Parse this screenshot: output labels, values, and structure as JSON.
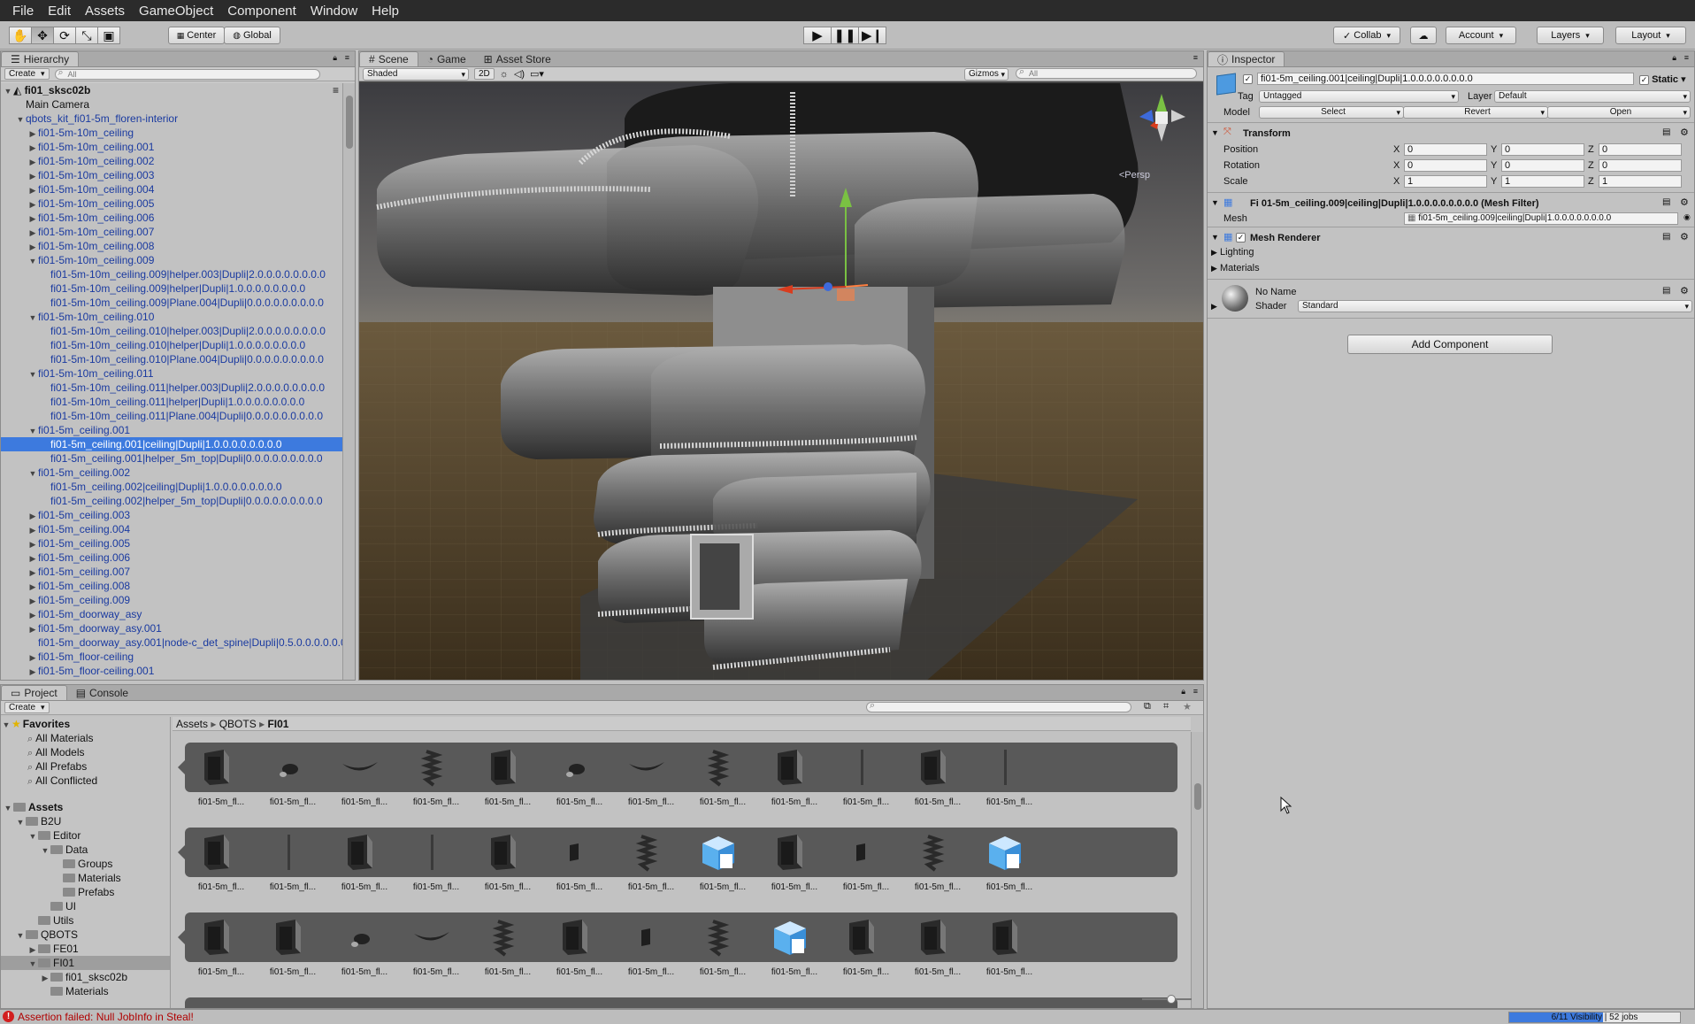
{
  "menubar": {
    "items": [
      "File",
      "Edit",
      "Assets",
      "GameObject",
      "Component",
      "Window",
      "Help"
    ]
  },
  "toolbar": {
    "pivot": "Center",
    "space": "Global",
    "collab": "Collab",
    "account": "Account",
    "layers": "Layers",
    "layout": "Layout"
  },
  "hierarchy": {
    "tab": "Hierarchy",
    "create": "Create",
    "search_placeholder": "All",
    "rows": [
      {
        "label": "fi01_sksc02b",
        "depth": 0,
        "arrow": "open",
        "kind": "scene"
      },
      {
        "label": "Main Camera",
        "depth": 1,
        "arrow": "none",
        "kind": "black"
      },
      {
        "label": "qbots_kit_fi01-5m_floren-interior",
        "depth": 1,
        "arrow": "open",
        "kind": "prefab"
      },
      {
        "label": "fi01-5m-10m_ceiling",
        "depth": 2,
        "arrow": "closed",
        "kind": "prefab"
      },
      {
        "label": "fi01-5m-10m_ceiling.001",
        "depth": 2,
        "arrow": "closed",
        "kind": "prefab"
      },
      {
        "label": "fi01-5m-10m_ceiling.002",
        "depth": 2,
        "arrow": "closed",
        "kind": "prefab"
      },
      {
        "label": "fi01-5m-10m_ceiling.003",
        "depth": 2,
        "arrow": "closed",
        "kind": "prefab"
      },
      {
        "label": "fi01-5m-10m_ceiling.004",
        "depth": 2,
        "arrow": "closed",
        "kind": "prefab"
      },
      {
        "label": "fi01-5m-10m_ceiling.005",
        "depth": 2,
        "arrow": "closed",
        "kind": "prefab"
      },
      {
        "label": "fi01-5m-10m_ceiling.006",
        "depth": 2,
        "arrow": "closed",
        "kind": "prefab"
      },
      {
        "label": "fi01-5m-10m_ceiling.007",
        "depth": 2,
        "arrow": "closed",
        "kind": "prefab"
      },
      {
        "label": "fi01-5m-10m_ceiling.008",
        "depth": 2,
        "arrow": "closed",
        "kind": "prefab"
      },
      {
        "label": "fi01-5m-10m_ceiling.009",
        "depth": 2,
        "arrow": "open",
        "kind": "prefab"
      },
      {
        "label": "fi01-5m-10m_ceiling.009|helper.003|Dupli|2.0.0.0.0.0.0.0.0",
        "depth": 3,
        "arrow": "none",
        "kind": "prefab"
      },
      {
        "label": "fi01-5m-10m_ceiling.009|helper|Dupli|1.0.0.0.0.0.0.0.0",
        "depth": 3,
        "arrow": "none",
        "kind": "prefab"
      },
      {
        "label": "fi01-5m-10m_ceiling.009|Plane.004|Dupli|0.0.0.0.0.0.0.0.0",
        "depth": 3,
        "arrow": "none",
        "kind": "prefab"
      },
      {
        "label": "fi01-5m-10m_ceiling.010",
        "depth": 2,
        "arrow": "open",
        "kind": "prefab"
      },
      {
        "label": "fi01-5m-10m_ceiling.010|helper.003|Dupli|2.0.0.0.0.0.0.0.0",
        "depth": 3,
        "arrow": "none",
        "kind": "prefab"
      },
      {
        "label": "fi01-5m-10m_ceiling.010|helper|Dupli|1.0.0.0.0.0.0.0.0",
        "depth": 3,
        "arrow": "none",
        "kind": "prefab"
      },
      {
        "label": "fi01-5m-10m_ceiling.010|Plane.004|Dupli|0.0.0.0.0.0.0.0.0",
        "depth": 3,
        "arrow": "none",
        "kind": "prefab"
      },
      {
        "label": "fi01-5m-10m_ceiling.011",
        "depth": 2,
        "arrow": "open",
        "kind": "prefab"
      },
      {
        "label": "fi01-5m-10m_ceiling.011|helper.003|Dupli|2.0.0.0.0.0.0.0.0",
        "depth": 3,
        "arrow": "none",
        "kind": "prefab"
      },
      {
        "label": "fi01-5m-10m_ceiling.011|helper|Dupli|1.0.0.0.0.0.0.0.0",
        "depth": 3,
        "arrow": "none",
        "kind": "prefab"
      },
      {
        "label": "fi01-5m-10m_ceiling.011|Plane.004|Dupli|0.0.0.0.0.0.0.0.0",
        "depth": 3,
        "arrow": "none",
        "kind": "prefab"
      },
      {
        "label": "fi01-5m_ceiling.001",
        "depth": 2,
        "arrow": "open",
        "kind": "prefab"
      },
      {
        "label": "fi01-5m_ceiling.001|ceiling|Dupli|1.0.0.0.0.0.0.0.0",
        "depth": 3,
        "arrow": "none",
        "kind": "selected"
      },
      {
        "label": "fi01-5m_ceiling.001|helper_5m_top|Dupli|0.0.0.0.0.0.0.0.0",
        "depth": 3,
        "arrow": "none",
        "kind": "prefab"
      },
      {
        "label": "fi01-5m_ceiling.002",
        "depth": 2,
        "arrow": "open",
        "kind": "prefab"
      },
      {
        "label": "fi01-5m_ceiling.002|ceiling|Dupli|1.0.0.0.0.0.0.0.0",
        "depth": 3,
        "arrow": "none",
        "kind": "prefab"
      },
      {
        "label": "fi01-5m_ceiling.002|helper_5m_top|Dupli|0.0.0.0.0.0.0.0.0",
        "depth": 3,
        "arrow": "none",
        "kind": "prefab"
      },
      {
        "label": "fi01-5m_ceiling.003",
        "depth": 2,
        "arrow": "closed",
        "kind": "prefab"
      },
      {
        "label": "fi01-5m_ceiling.004",
        "depth": 2,
        "arrow": "closed",
        "kind": "prefab"
      },
      {
        "label": "fi01-5m_ceiling.005",
        "depth": 2,
        "arrow": "closed",
        "kind": "prefab"
      },
      {
        "label": "fi01-5m_ceiling.006",
        "depth": 2,
        "arrow": "closed",
        "kind": "prefab"
      },
      {
        "label": "fi01-5m_ceiling.007",
        "depth": 2,
        "arrow": "closed",
        "kind": "prefab"
      },
      {
        "label": "fi01-5m_ceiling.008",
        "depth": 2,
        "arrow": "closed",
        "kind": "prefab"
      },
      {
        "label": "fi01-5m_ceiling.009",
        "depth": 2,
        "arrow": "closed",
        "kind": "prefab"
      },
      {
        "label": "fi01-5m_doorway_asy",
        "depth": 2,
        "arrow": "closed",
        "kind": "prefab"
      },
      {
        "label": "fi01-5m_doorway_asy.001",
        "depth": 2,
        "arrow": "closed",
        "kind": "prefab"
      },
      {
        "label": "fi01-5m_doorway_asy.001|node-c_det_spine|Dupli|0.5.0.0.0.0.0.0",
        "depth": 2,
        "arrow": "none",
        "kind": "prefab"
      },
      {
        "label": "fi01-5m_floor-ceiling",
        "depth": 2,
        "arrow": "closed",
        "kind": "prefab"
      },
      {
        "label": "fi01-5m_floor-ceiling.001",
        "depth": 2,
        "arrow": "closed",
        "kind": "prefab"
      }
    ]
  },
  "scene": {
    "tabs": [
      "Scene",
      "Game",
      "Asset Store"
    ],
    "shading": "Shaded",
    "mode_2d": "2D",
    "gizmos": "Gizmos",
    "search_placeholder": "All",
    "persp_label": "Persp"
  },
  "inspector": {
    "tab": "Inspector",
    "object_name": "fi01-5m_ceiling.001|ceiling|Dupli|1.0.0.0.0.0.0.0.0",
    "static_label": "Static",
    "tag_label": "Tag",
    "tag_value": "Untagged",
    "layer_label": "Layer",
    "layer_value": "Default",
    "model_label": "Model",
    "model_buttons": [
      "Select",
      "Revert",
      "Open"
    ],
    "transform": {
      "title": "Transform",
      "rows": [
        {
          "label": "Position",
          "x": "0",
          "y": "0",
          "z": "0"
        },
        {
          "label": "Rotation",
          "x": "0",
          "y": "0",
          "z": "0"
        },
        {
          "label": "Scale",
          "x": "1",
          "y": "1",
          "z": "1"
        }
      ]
    },
    "mesh_filter": {
      "title": "Fi 01-5m_ceiling.009|ceiling|Dupli|1.0.0.0.0.0.0.0.0 (Mesh Filter)",
      "mesh_label": "Mesh",
      "mesh_value": "fi01-5m_ceiling.009|ceiling|Dupli|1.0.0.0.0.0.0.0.0"
    },
    "mesh_renderer": {
      "title": "Mesh Renderer",
      "lighting": "Lighting",
      "materials": "Materials"
    },
    "material": {
      "name": "No Name",
      "shader_label": "Shader",
      "shader_value": "Standard"
    },
    "add_component": "Add Component"
  },
  "project": {
    "tabs": [
      "Project",
      "Console"
    ],
    "create": "Create",
    "favorites": {
      "title": "Favorites",
      "items": [
        "All Materials",
        "All Models",
        "All Prefabs",
        "All Conflicted"
      ]
    },
    "tree": [
      {
        "label": "Assets",
        "depth": 0,
        "arrow": "open",
        "bold": true
      },
      {
        "label": "B2U",
        "depth": 1,
        "arrow": "open"
      },
      {
        "label": "Editor",
        "depth": 2,
        "arrow": "open"
      },
      {
        "label": "Data",
        "depth": 3,
        "arrow": "open"
      },
      {
        "label": "Groups",
        "depth": 4,
        "arrow": "none"
      },
      {
        "label": "Materials",
        "depth": 4,
        "arrow": "none"
      },
      {
        "label": "Prefabs",
        "depth": 4,
        "arrow": "none"
      },
      {
        "label": "UI",
        "depth": 3,
        "arrow": "none"
      },
      {
        "label": "Utils",
        "depth": 2,
        "arrow": "none"
      },
      {
        "label": "QBOTS",
        "depth": 1,
        "arrow": "open"
      },
      {
        "label": "FE01",
        "depth": 2,
        "arrow": "closed"
      },
      {
        "label": "FI01",
        "depth": 2,
        "arrow": "open",
        "selected": true
      },
      {
        "label": "fi01_sksc02b",
        "depth": 3,
        "arrow": "closed"
      },
      {
        "label": "Materials",
        "depth": 3,
        "arrow": "none"
      }
    ],
    "breadcrumb": [
      "Assets",
      "QBOTS",
      "FI01"
    ],
    "thumb_label": "fi01-5m_fl...",
    "strips": [
      [
        "door",
        "bolt",
        "sweep",
        "spring",
        "door",
        "bolt",
        "sweep",
        "spring",
        "door",
        "rod",
        "door",
        "rod"
      ],
      [
        "door",
        "rod",
        "door",
        "rod",
        "door",
        "bit",
        "spring",
        "cube",
        "door",
        "bit",
        "spring",
        "cube"
      ],
      [
        "door",
        "door",
        "bolt",
        "sweep",
        "spring",
        "door",
        "bit",
        "spring",
        "cube",
        "door",
        "door",
        "door"
      ]
    ]
  },
  "status": {
    "message": "Assertion failed: Null JobInfo in Steal!",
    "progress_text": "6/11 Visibility | 52 jobs",
    "progress_value": 0.55
  }
}
